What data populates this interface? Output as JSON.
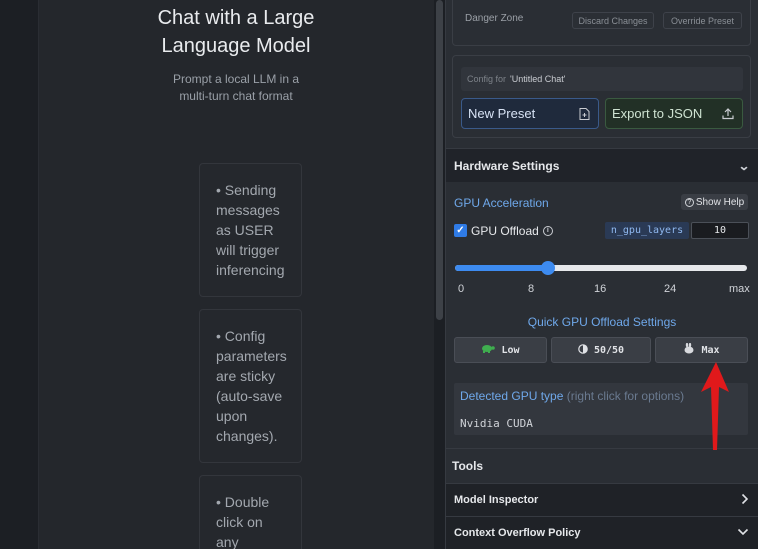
{
  "chat": {
    "title_line1": "Chat with a Large",
    "title_line2": "Language Model",
    "subtitle_line1": "Prompt a local LLM in a",
    "subtitle_line2": "multi-turn chat format",
    "tips": [
      {
        "lines": [
          "• Sending",
          "messages",
          "as USER",
          "will trigger",
          "inferencing"
        ]
      },
      {
        "lines": [
          "• Config",
          "parameters",
          "are sticky",
          "(auto-save",
          "upon",
          "changes)."
        ]
      },
      {
        "lines": [
          "• Double",
          "click on",
          "any"
        ]
      }
    ]
  },
  "danger_zone": {
    "label": "Danger Zone",
    "discard_label": "Discard Changes",
    "override_label": "Override Preset"
  },
  "config": {
    "prefix": "Config for",
    "name": "'Untitled Chat'",
    "new_preset_label": "New Preset",
    "export_label": "Export to JSON"
  },
  "hardware": {
    "header": "Hardware Settings",
    "gpu_accel_label": "GPU Acceleration",
    "show_help_label": "Show Help",
    "gpu_offload_label": "GPU Offload",
    "gpu_offload_checked": true,
    "n_gpu_layers_label": "n_gpu_layers",
    "n_gpu_layers_value": "10",
    "slider_ticks": [
      "0",
      "8",
      "16",
      "24",
      "max"
    ],
    "slider_fraction": 0.32,
    "quick_title": "Quick GPU Offload Settings",
    "quick_buttons": [
      {
        "icon": "turtle-icon",
        "label": "Low"
      },
      {
        "icon": "half-circle-icon",
        "label": "50/50"
      },
      {
        "icon": "rabbit-icon",
        "label": "Max"
      }
    ],
    "detected_title": "Detected GPU type",
    "detected_hint": "(right click for options)",
    "detected_value": "Nvidia CUDA"
  },
  "tools": {
    "header": "Tools",
    "items": [
      {
        "label": "Model Inspector",
        "icon": "chevron-right-icon"
      },
      {
        "label": "Context Overflow Policy",
        "icon": "chevron-down-icon"
      }
    ]
  },
  "colors": {
    "accent": "#3d8bf0",
    "link": "#6fa8ea",
    "annotation_arrow": "#e0191b"
  }
}
